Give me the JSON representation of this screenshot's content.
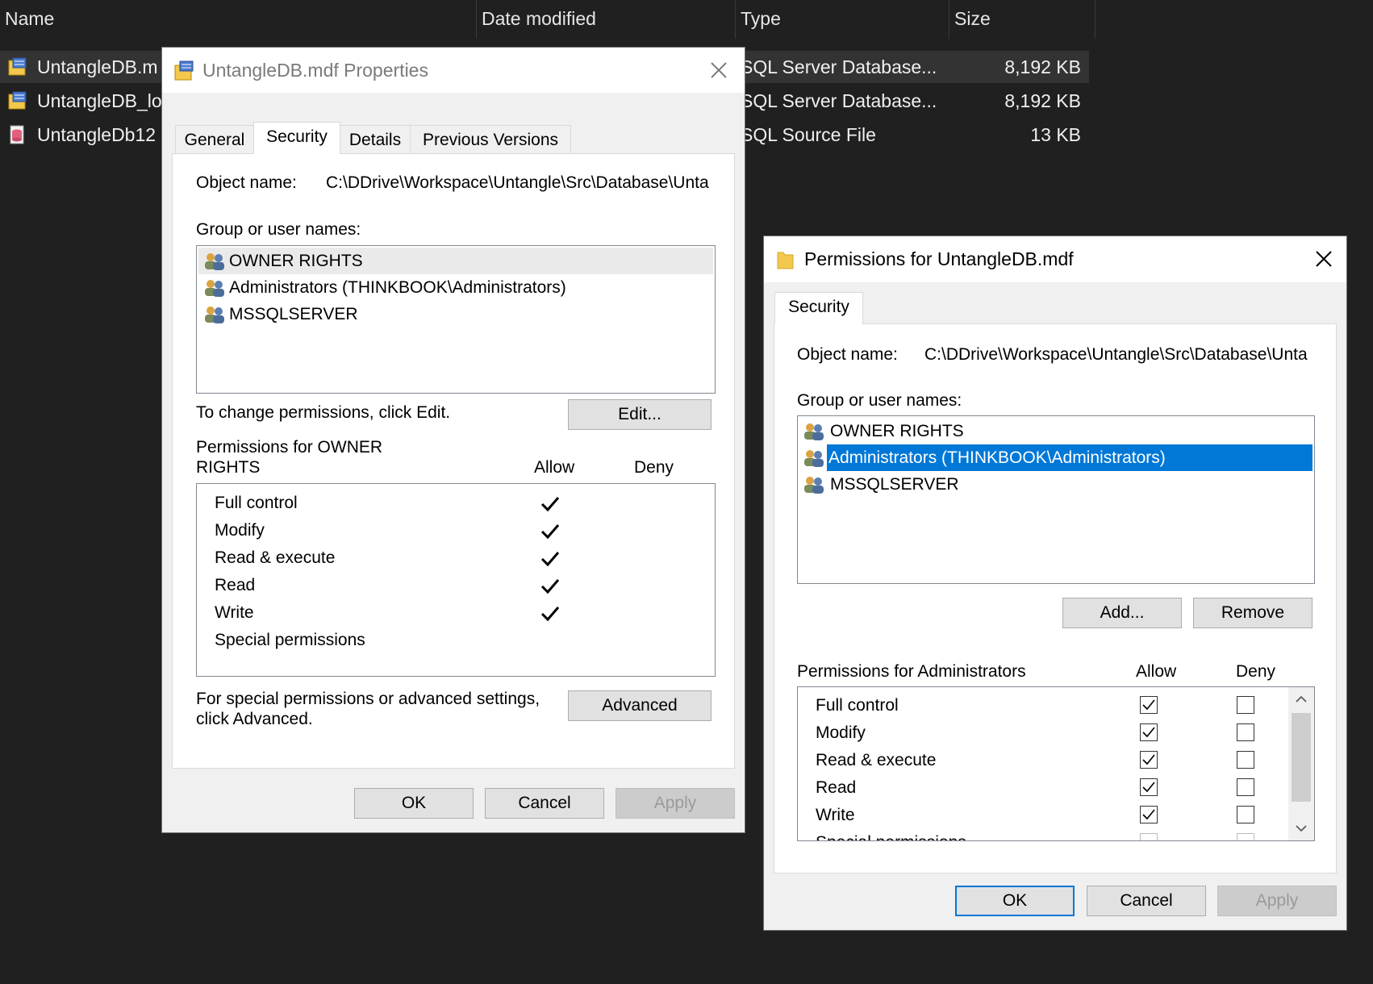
{
  "explorer": {
    "columns": {
      "name": "Name",
      "date": "Date modified",
      "type": "Type",
      "size": "Size"
    },
    "files": [
      {
        "name": "UntangleDB.m",
        "type": "SQL Server Database...",
        "size": "8,192 KB"
      },
      {
        "name": "UntangleDB_lo",
        "type": "SQL Server Database...",
        "size": "8,192 KB"
      },
      {
        "name": "UntangleDb12",
        "type": "SQL Source File",
        "size": "13 KB"
      }
    ]
  },
  "properties": {
    "title": "UntangleDB.mdf Properties",
    "tabs": [
      "General",
      "Security",
      "Details",
      "Previous Versions"
    ],
    "object_label": "Object name:",
    "object_value": "C:\\DDrive\\Workspace\\Untangle\\Src\\Database\\Unta",
    "group_label": "Group or user names:",
    "users": [
      "OWNER RIGHTS",
      "Administrators (THINKBOOK\\Administrators)",
      "MSSQLSERVER"
    ],
    "change_text": "To change permissions, click Edit.",
    "edit_button": "Edit...",
    "perm_title_line1": "Permissions for OWNER",
    "perm_title_line2": "RIGHTS",
    "allow": "Allow",
    "deny": "Deny",
    "permissions": [
      "Full control",
      "Modify",
      "Read & execute",
      "Read",
      "Write",
      "Special permissions"
    ],
    "special_line1": "For special permissions or advanced settings,",
    "special_line2": "click Advanced.",
    "advanced_button": "Advanced",
    "ok": "OK",
    "cancel": "Cancel",
    "apply": "Apply"
  },
  "perm_dialog": {
    "title": "Permissions for UntangleDB.mdf",
    "tab": "Security",
    "object_label": "Object name:",
    "object_value": "C:\\DDrive\\Workspace\\Untangle\\Src\\Database\\Unta",
    "group_label": "Group or user names:",
    "users": [
      "OWNER RIGHTS",
      "Administrators (THINKBOOK\\Administrators)",
      "MSSQLSERVER"
    ],
    "add_button": "Add...",
    "remove_button": "Remove",
    "perm_title": "Permissions for Administrators",
    "allow": "Allow",
    "deny": "Deny",
    "permissions": [
      "Full control",
      "Modify",
      "Read & execute",
      "Read",
      "Write",
      "Special permissions"
    ],
    "ok": "OK",
    "cancel": "Cancel",
    "apply": "Apply"
  },
  "colors": {
    "selection": "#0078d7",
    "explorer_bg": "#202020",
    "dialog_bg": "#f0f0f0"
  }
}
